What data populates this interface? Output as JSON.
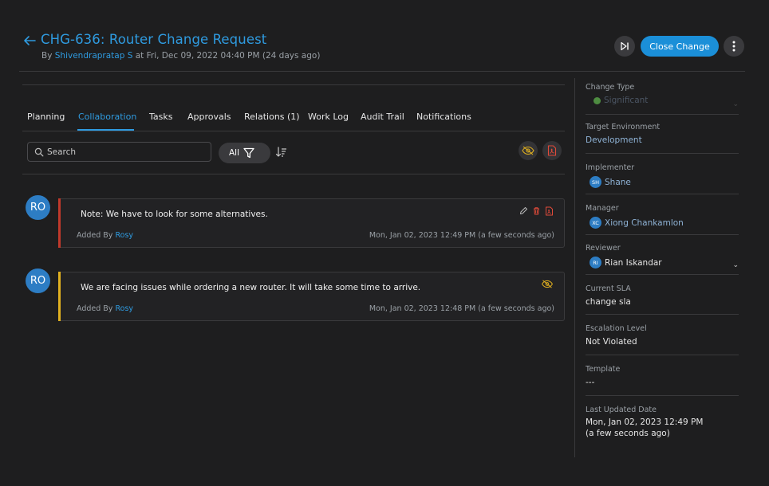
{
  "header": {
    "title": "CHG-636: Router Change Request",
    "subtitle_by": "By ",
    "subtitle_author": "Shivendrapratap S",
    "subtitle_rest": " at Fri, Dec 09, 2022 04:40 PM (24 days ago)",
    "close_label": "Close Change",
    "more_label": "⋮"
  },
  "tabs": [
    {
      "label": "Planning"
    },
    {
      "label": "Collaboration",
      "active": true
    },
    {
      "label": "Tasks"
    },
    {
      "label": "Approvals"
    },
    {
      "label": "Relations (1)"
    },
    {
      "label": "Work Log"
    },
    {
      "label": "Audit Trail"
    },
    {
      "label": "Notifications"
    }
  ],
  "toolbar": {
    "search_placeholder": "Search",
    "filter_label": "All"
  },
  "notes": [
    {
      "avatar": "RO",
      "text": "Note: We have to look for some alternatives.",
      "added_by_prefix": "Added By ",
      "added_by": "Rosy",
      "date": "Mon, Jan 02, 2023 12:49 PM (a few seconds ago)",
      "bar_color": "#c0392b"
    },
    {
      "avatar": "RO",
      "text": "We are facing issues while ordering a new router. It will take some time to arrive.",
      "added_by_prefix": "Added By ",
      "added_by": "Rosy",
      "date": "Mon, Jan 02, 2023 12:48 PM (a few seconds ago)",
      "bar_color": "#e0b020"
    }
  ],
  "sidebar": {
    "change_type": {
      "label": "Change Type",
      "value": "Significant"
    },
    "target_env": {
      "label": "Target Environment",
      "value": "Development"
    },
    "implementer": {
      "label": "Implementer",
      "initials": "SH",
      "value": "Shane"
    },
    "manager": {
      "label": "Manager",
      "initials": "XC",
      "value": "Xiong Chankamlon"
    },
    "reviewer": {
      "label": "Reviewer",
      "initials": "RI",
      "value": "Rian Iskandar"
    },
    "sla": {
      "label": "Current SLA",
      "value": "change sla"
    },
    "escalation": {
      "label": "Escalation Level",
      "value": "Not Violated"
    },
    "template": {
      "label": "Template",
      "value": "---"
    },
    "updated": {
      "label": "Last Updated Date",
      "value": "Mon, Jan 02, 2023 12:49 PM",
      "relative": "(a few seconds ago)"
    }
  },
  "colors": {
    "accent": "#1b8fd8",
    "link": "#2f9be0",
    "background": "#1e1e1f"
  }
}
